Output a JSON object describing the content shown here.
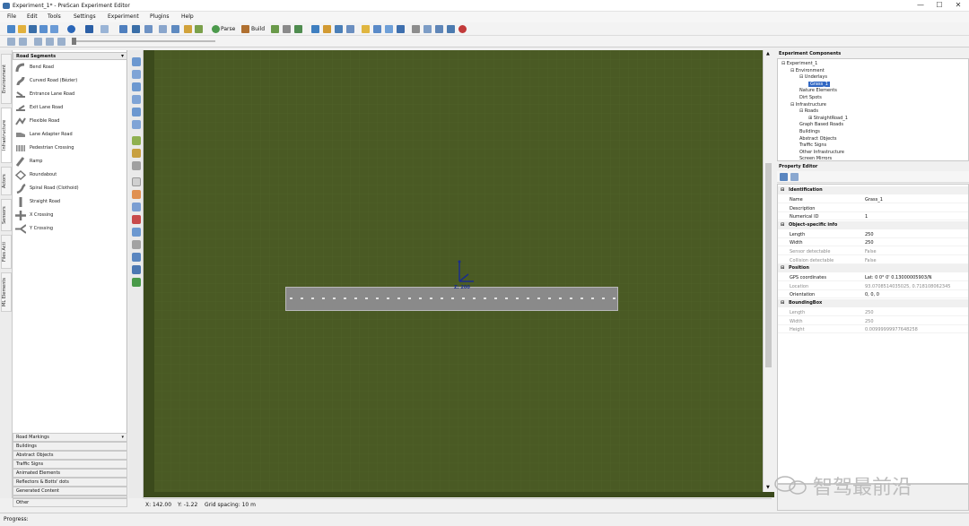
{
  "window": {
    "title": "Experiment_1* - PreScan Experiment Editor",
    "minimize": "—",
    "maximize": "☐",
    "close": "✕"
  },
  "menu": [
    "File",
    "Edit",
    "Tools",
    "Settings",
    "Experiment",
    "Plugins",
    "Help"
  ],
  "toolbar": {
    "parse_label": "Parse",
    "build_label": "Build"
  },
  "vertical_tabs": [
    "Environment",
    "Infrastructure",
    "Actors",
    "Sensors",
    "Files Acti",
    "ML Elements"
  ],
  "road_segments": {
    "header": "Road Segments",
    "items": [
      {
        "label": "Bend Road",
        "icon": "bend-road-icon"
      },
      {
        "label": "Curved Road (Bézier)",
        "icon": "curved-road-icon"
      },
      {
        "label": "Entrance Lane Road",
        "icon": "entrance-lane-icon"
      },
      {
        "label": "Exit Lane Road",
        "icon": "exit-lane-icon"
      },
      {
        "label": "Flexible Road",
        "icon": "flexible-road-icon"
      },
      {
        "label": "Lane Adapter Road",
        "icon": "lane-adapter-icon"
      },
      {
        "label": "Pedestrian Crossing",
        "icon": "pedestrian-crossing-icon"
      },
      {
        "label": "Ramp",
        "icon": "ramp-icon"
      },
      {
        "label": "Roundabout",
        "icon": "roundabout-icon"
      },
      {
        "label": "Spiral Road (Clothoid)",
        "icon": "spiral-road-icon"
      },
      {
        "label": "Straight Road",
        "icon": "straight-road-icon"
      },
      {
        "label": "X Crossing",
        "icon": "x-crossing-icon"
      },
      {
        "label": "Y Crossing",
        "icon": "y-crossing-icon"
      }
    ]
  },
  "categories": [
    "Road Markings",
    "Buildings",
    "Abstract Objects",
    "Traffic Signs",
    "Animated Elements",
    "Reflectors & Botts' dots",
    "Generated Content",
    "Other"
  ],
  "component_tree": {
    "title": "Experiment Components",
    "nodes": [
      {
        "label": "Experiment_1",
        "depth": 0,
        "toggle": "⊟"
      },
      {
        "label": "Environment",
        "depth": 1,
        "toggle": "⊟"
      },
      {
        "label": "Underlays",
        "depth": 2,
        "toggle": "⊟"
      },
      {
        "label": "Grass_1",
        "depth": 3,
        "toggle": "",
        "selected": true
      },
      {
        "label": "Nature Elements",
        "depth": 2,
        "toggle": ""
      },
      {
        "label": "Dirt Spots",
        "depth": 2,
        "toggle": ""
      },
      {
        "label": "Infrastructure",
        "depth": 1,
        "toggle": "⊟"
      },
      {
        "label": "Roads",
        "depth": 2,
        "toggle": "⊟"
      },
      {
        "label": "StraightRoad_1",
        "depth": 3,
        "toggle": "⊞"
      },
      {
        "label": "Graph Based Roads",
        "depth": 2,
        "toggle": ""
      },
      {
        "label": "Buildings",
        "depth": 2,
        "toggle": ""
      },
      {
        "label": "Abstract Objects",
        "depth": 2,
        "toggle": ""
      },
      {
        "label": "Traffic Signs",
        "depth": 2,
        "toggle": ""
      },
      {
        "label": "Other Infrastructure",
        "depth": 2,
        "toggle": ""
      },
      {
        "label": "Screen Mirrors",
        "depth": 2,
        "toggle": ""
      }
    ]
  },
  "property_editor": {
    "title": "Property Editor",
    "sections": [
      {
        "title": "Identification",
        "rows": [
          {
            "key": "Name",
            "value": "Grass_1",
            "dim": false
          },
          {
            "key": "Description",
            "value": "",
            "dim": false
          },
          {
            "key": "Numerical ID",
            "value": "1",
            "dim": false
          }
        ]
      },
      {
        "title": "Object-specific info",
        "rows": [
          {
            "key": "Length",
            "value": "250",
            "dim": false
          },
          {
            "key": "Width",
            "value": "250",
            "dim": false
          },
          {
            "key": "Sensor detectable",
            "value": "False",
            "dim": true
          },
          {
            "key": "Collision detectable",
            "value": "False",
            "dim": true
          }
        ]
      },
      {
        "title": "Position",
        "rows": [
          {
            "key": "GPS coordinates",
            "value": "Lat: 0 0° 0' 0.13000005903/N",
            "dim": false
          },
          {
            "key": "Location",
            "value": "93.0708514035025, 0.718108062345",
            "dim": true
          },
          {
            "key": "Orientation",
            "value": "0, 0, 0",
            "dim": false
          }
        ]
      },
      {
        "title": "BoundingBox",
        "rows": [
          {
            "key": "Length",
            "value": "250",
            "dim": true
          },
          {
            "key": "Width",
            "value": "250",
            "dim": true
          },
          {
            "key": "Height",
            "value": "0.00999999977648258",
            "dim": true
          }
        ]
      }
    ]
  },
  "viewport": {
    "axis_label": "Z: 200"
  },
  "status": {
    "x": "X: 142.00",
    "y": "Y: -1.22",
    "grid": "Grid spacing: 10 m"
  },
  "progress_label": "Progress:",
  "watermark": "智驾最前沿",
  "colors": {
    "grass": "#4a5a24",
    "road": "#8a8a8a",
    "selection": "#3168c4"
  }
}
